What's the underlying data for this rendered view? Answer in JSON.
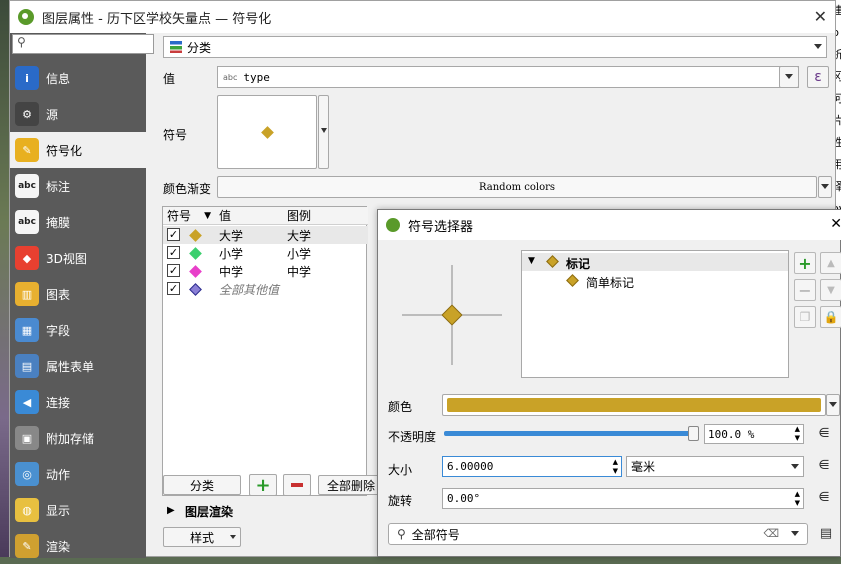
{
  "main_window": {
    "title": "图层属性 - 历下区学校矢量点 — 符号化",
    "close": "✕"
  },
  "sidebar": {
    "items": [
      {
        "label": "信息",
        "icon": "info-icon"
      },
      {
        "label": "源",
        "icon": "source-icon"
      },
      {
        "label": "符号化",
        "icon": "symbology-icon"
      },
      {
        "label": "标注",
        "icon": "labels-icon"
      },
      {
        "label": "掩膜",
        "icon": "mask-icon"
      },
      {
        "label": "3D视图",
        "icon": "3d-view-icon"
      },
      {
        "label": "图表",
        "icon": "diagram-icon"
      },
      {
        "label": "字段",
        "icon": "fields-icon"
      },
      {
        "label": "属性表单",
        "icon": "attributes-form-icon"
      },
      {
        "label": "连接",
        "icon": "joins-icon"
      },
      {
        "label": "附加存储",
        "icon": "auxiliary-storage-icon"
      },
      {
        "label": "动作",
        "icon": "actions-icon"
      },
      {
        "label": "显示",
        "icon": "display-icon"
      },
      {
        "label": "渲染",
        "icon": "rendering-icon"
      }
    ]
  },
  "symbology": {
    "renderer": "分类",
    "value_label": "值",
    "value_field": "type",
    "value_type_tag": "abc",
    "symbol_label": "符号",
    "ramp_label": "颜色渐变",
    "ramp_value": "Random colors",
    "table": {
      "headers": [
        "符号",
        "值",
        "图例"
      ],
      "rows": [
        {
          "value": "大学",
          "legend": "大学",
          "color": "#c9a227"
        },
        {
          "value": "小学",
          "legend": "小学",
          "color": "#3ccf6e"
        },
        {
          "value": "中学",
          "legend": "中学",
          "color": "#e83fc9"
        },
        {
          "value": "全部其他值",
          "legend": "",
          "color": "#8a7fd6"
        }
      ]
    },
    "classify_button": "分类",
    "delete_all_button": "全部删除",
    "layer_rendering": "图层渲染",
    "style_button": "样式"
  },
  "symbol_selector": {
    "title": "符号选择器",
    "tree_root": "标记",
    "tree_child": "简单标记",
    "color_label": "颜色",
    "marker_color": "#c9a227",
    "opacity_label": "不透明度",
    "opacity_value": "100.0 %",
    "opacity_fraction": 1.0,
    "size_label": "大小",
    "size_value": "6.00000",
    "size_unit": "毫米",
    "rotation_label": "旋转",
    "rotation_value": "0.00°",
    "search_placeholder": "全部符号"
  },
  "right_strip_text": "建 b 析 冈 何 片 性 用 择 ov"
}
